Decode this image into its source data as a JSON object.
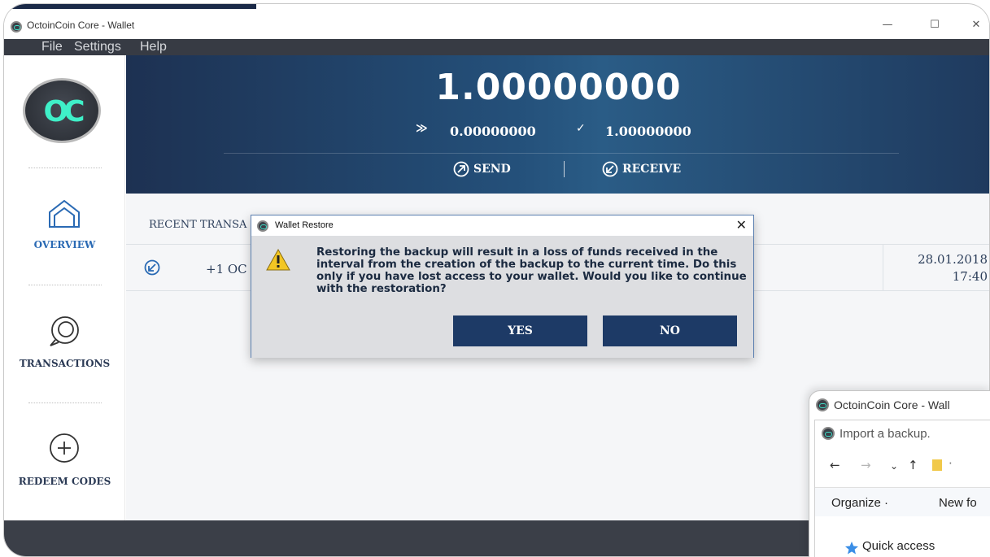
{
  "window": {
    "title": "OctoinCoin Core - Wallet",
    "minimize": "—",
    "maximize": "☐",
    "close": "✕"
  },
  "menu": [
    "File",
    "Settings",
    "Help"
  ],
  "sidebar": {
    "logo_text": "OC",
    "items": [
      {
        "label": "OVERVIEW",
        "icon": "house-icon",
        "active": true
      },
      {
        "label": "TRANSACTIONS",
        "icon": "search-bubble-icon",
        "active": false
      },
      {
        "label": "REDEEM CODES",
        "icon": "plus-circle-icon",
        "active": false
      }
    ]
  },
  "header": {
    "balance": "1.00000000",
    "pending": "0.00000000",
    "available": "1.00000000",
    "send_label": "SEND",
    "receive_label": "RECEIVE"
  },
  "content": {
    "section_title": "RECENT TRANSA",
    "transactions": [
      {
        "amount": "+1 OC",
        "date": "28.01.2018",
        "time": "17:40"
      }
    ]
  },
  "dialog": {
    "title": "Wallet Restore",
    "close": "✕",
    "message": "Restoring the backup will result in a loss of funds received in the interval from the creation of the backup to the current time. Do this only if you have lost access to your wallet. Would you like to continue with the restoration?",
    "yes_label": "YES",
    "no_label": "NO"
  },
  "file_dialog": {
    "window_title": "OctoinCoin Core - Wall",
    "subtitle": "Import a backup.",
    "organize_label": "Organize ·",
    "new_folder_label": "New fo",
    "quick_access_label": "Quick access"
  },
  "colors": {
    "accent": "#3ff0c8",
    "header_blue": "#24507a",
    "button_navy": "#1d3a66",
    "nav_active": "#2a6ab4"
  }
}
